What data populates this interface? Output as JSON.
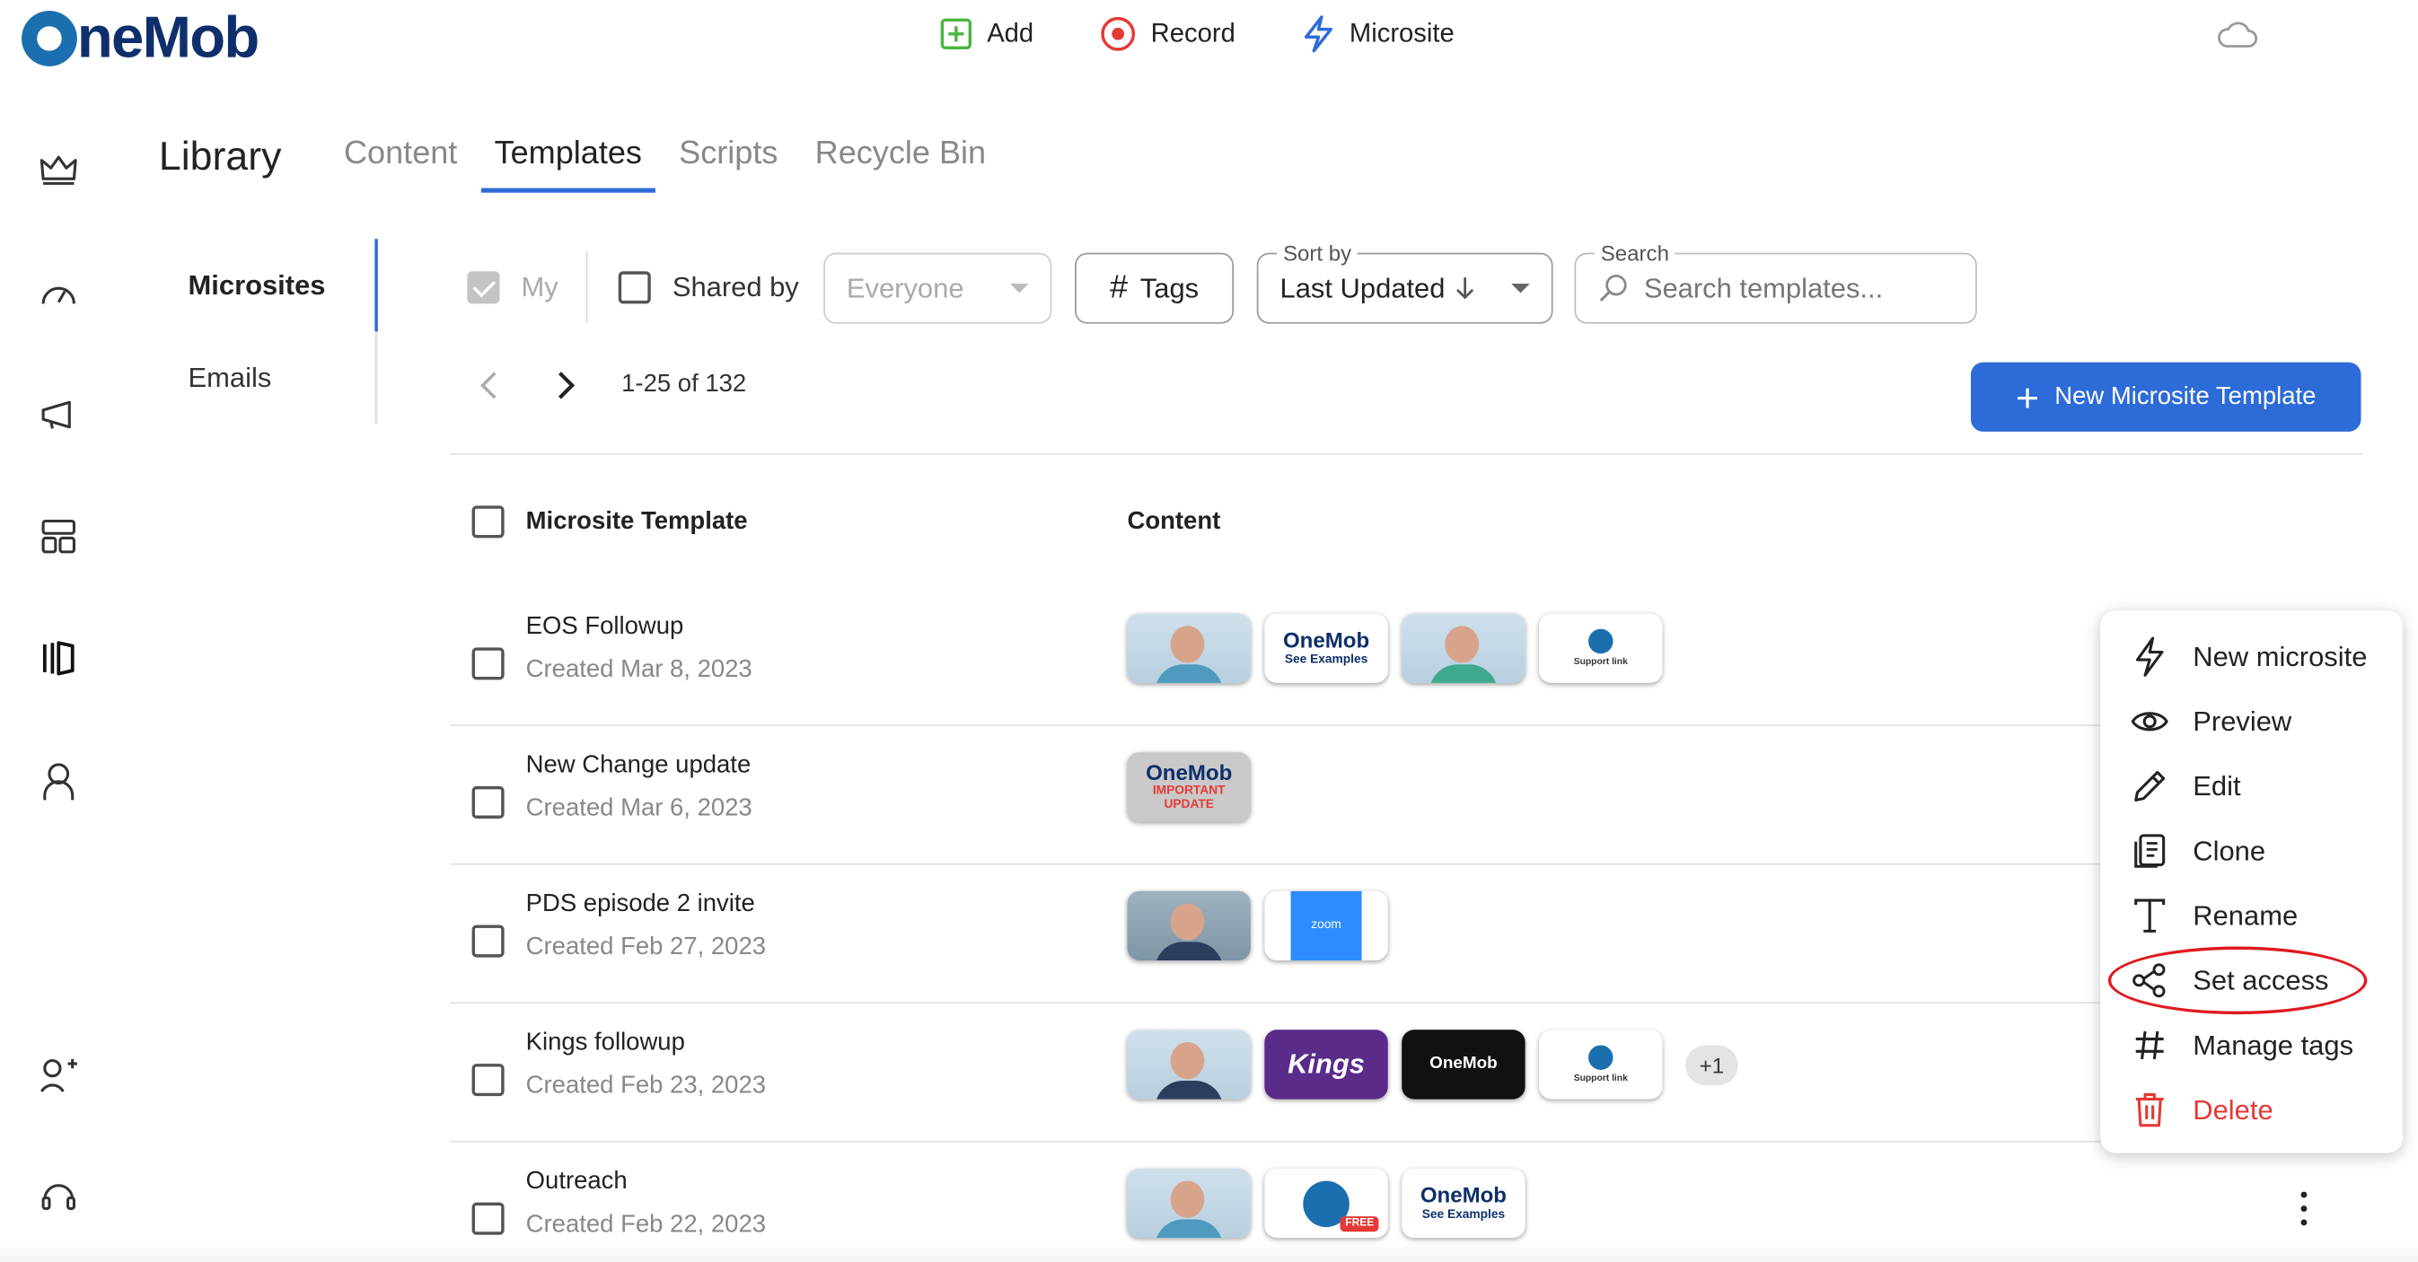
{
  "header": {
    "logo_text": "neMob",
    "actions": [
      {
        "label": "Add",
        "icon": "add-square-icon"
      },
      {
        "label": "Record",
        "icon": "record-icon"
      },
      {
        "label": "Microsite",
        "icon": "bolt-icon"
      }
    ]
  },
  "library": {
    "title": "Library",
    "tabs": [
      "Content",
      "Templates",
      "Scripts",
      "Recycle Bin"
    ],
    "active_tab": "Templates",
    "subnav": [
      "Microsites",
      "Emails"
    ],
    "active_subnav": "Microsites"
  },
  "filters": {
    "my_label": "My",
    "my_checked": true,
    "shared_by_label": "Shared by",
    "shared_by_value": "Everyone",
    "tags_label": "Tags",
    "sort_by_label": "Sort by",
    "sort_by_value": "Last Updated",
    "search_label": "Search",
    "search_placeholder": "Search templates..."
  },
  "pager": {
    "range": "1-25 of 132"
  },
  "new_button_label": "New Microsite Template",
  "table": {
    "columns": [
      "Microsite Template",
      "Content"
    ],
    "rows": [
      {
        "title": "EOS Followup",
        "created": "Created Mar 8, 2023"
      },
      {
        "title": "New Change update",
        "created": "Created Mar 6, 2023"
      },
      {
        "title": "PDS episode 2 invite",
        "created": "Created Feb 27, 2023"
      },
      {
        "title": "Kings followup",
        "created": "Created Feb 23, 2023",
        "more": "+1"
      },
      {
        "title": "Outreach",
        "created": "Created Feb 22, 2023"
      }
    ]
  },
  "thumb_text": {
    "onemob": "OneMob",
    "see_examples": "See Examples",
    "important_update": "IMPORTANT UPDATE",
    "support_link": "Support link",
    "zoom": "zoom",
    "kings": "Kings",
    "free": "FREE"
  },
  "context_menu": {
    "items": [
      {
        "label": "New microsite",
        "icon": "bolt-icon"
      },
      {
        "label": "Preview",
        "icon": "eye-icon"
      },
      {
        "label": "Edit",
        "icon": "pencil-icon"
      },
      {
        "label": "Clone",
        "icon": "clone-icon"
      },
      {
        "label": "Rename",
        "icon": "text-icon"
      },
      {
        "label": "Set access",
        "icon": "share-icon"
      },
      {
        "label": "Manage tags",
        "icon": "hash-icon"
      },
      {
        "label": "Delete",
        "icon": "trash-icon"
      }
    ],
    "highlighted": "Set access"
  },
  "colors": {
    "accent": "#2d6bd8",
    "danger": "#e53935",
    "add_green": "#4bb543",
    "highlight_red": "#e0191e"
  }
}
